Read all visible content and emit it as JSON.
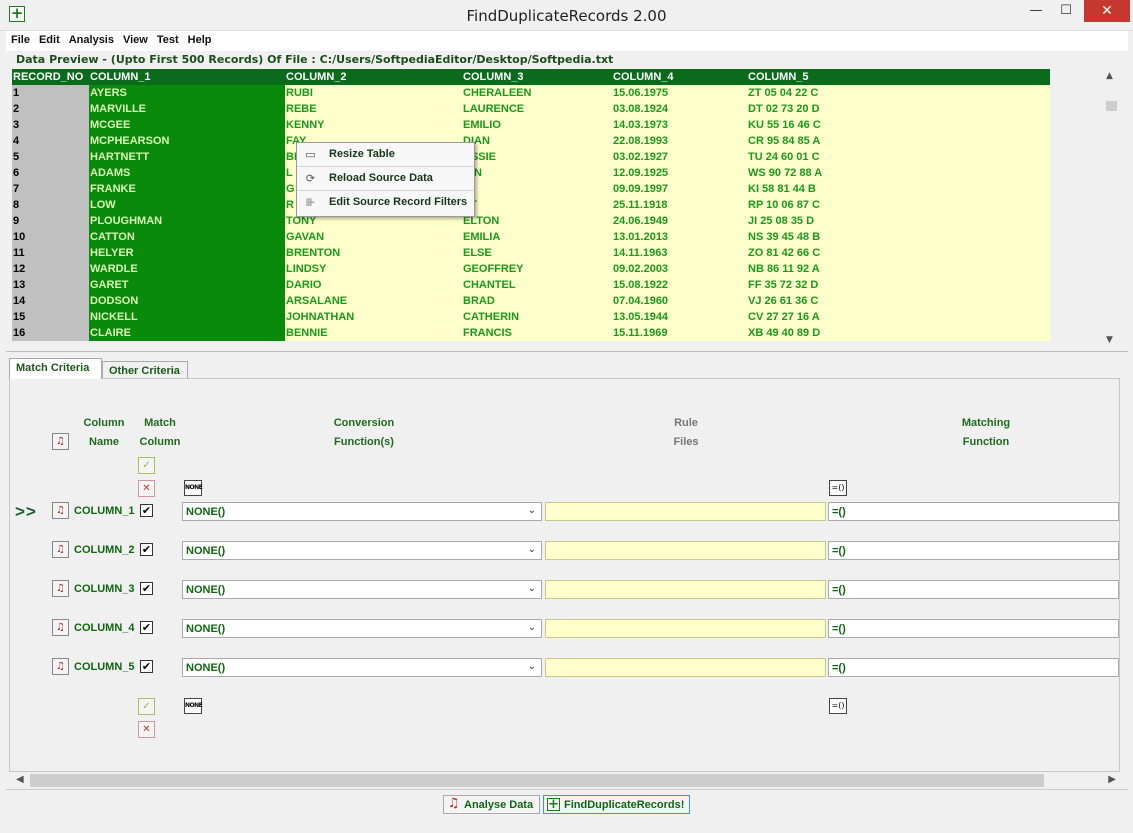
{
  "window": {
    "title": "FindDuplicateRecords 2.00",
    "minimize_glyph": "—",
    "maximize_glyph": "☐",
    "close_glyph": "✕"
  },
  "menu": [
    "File",
    "Edit",
    "Analysis",
    "View",
    "Test",
    "Help"
  ],
  "preview": {
    "caption": "Data Preview - (Upto First 500 Records) Of File  : C:/Users/SoftpediaEditor/Desktop/Softpedia.txt",
    "headers": [
      "RECORD_NO",
      "COLUMN_1",
      "COLUMN_2",
      "COLUMN_3",
      "COLUMN_4",
      "COLUMN_5"
    ],
    "rows": [
      [
        "1",
        "AYERS",
        "RUBI",
        "CHERALEEN",
        "15.06.1975",
        "ZT 05 04 22 C"
      ],
      [
        "2",
        "MARVILLE",
        "REBE",
        "LAURENCE",
        "03.08.1924",
        "DT 02 73 20 D"
      ],
      [
        "3",
        "MCGEE",
        "KENNY",
        "EMILIO",
        "14.03.1973",
        "KU 55 16 46 C"
      ],
      [
        "4",
        "MCPHEARSON",
        "FAY",
        "DIAN",
        "22.08.1993",
        "CR 95 84 85 A"
      ],
      [
        "5",
        "HARTNETT",
        "BI",
        "ASSIE",
        "03.02.1927",
        "TU 24 60 01 C"
      ],
      [
        "6",
        "ADAMS",
        "L",
        "AIN",
        "12.09.1925",
        "WS 90 72 88 A"
      ],
      [
        "7",
        "FRANKE",
        "G",
        "N",
        "09.09.1997",
        "KI 58 81 44 B"
      ],
      [
        "8",
        "LOW",
        "R",
        "AT",
        "25.11.1918",
        "RP 10 06 87 C"
      ],
      [
        "9",
        "PLOUGHMAN",
        "TONY",
        "ELTON",
        "24.06.1949",
        "JI 25 08 35 D"
      ],
      [
        "10",
        "CATTON",
        "GAVAN",
        "EMILIA",
        "13.01.2013",
        "NS 39 45 48 B"
      ],
      [
        "11",
        "HELYER",
        "BRENTON",
        "ELSE",
        "14.11.1963",
        "ZO 81 42 66 C"
      ],
      [
        "12",
        "WARDLE",
        "LINDSY",
        "GEOFFREY",
        "09.02.2003",
        "NB 86 11 92 A"
      ],
      [
        "13",
        "GARET",
        "DARIO",
        "CHANTEL",
        "15.08.1922",
        "FF 35 72 32 D"
      ],
      [
        "14",
        "DODSON",
        "ARSALANE",
        "BRAD",
        "07.04.1960",
        "VJ 26 61 36 C"
      ],
      [
        "15",
        "NICKELL",
        "JOHNATHAN",
        "CATHERIN",
        "13.05.1944",
        "CV 27 27 16 A"
      ],
      [
        "16",
        "CLAIRE",
        "BENNIE",
        "FRANCIS",
        "15.11.1969",
        "XB 49 40 89 D"
      ]
    ]
  },
  "context_menu": {
    "items": [
      {
        "label": "Resize Table",
        "icon": "resize-table-icon",
        "glyph": "▭"
      },
      {
        "label": "Reload Source Data",
        "icon": "reload-icon",
        "glyph": "⟳"
      },
      {
        "label": "Edit Source Record Filters",
        "icon": "filter-icon",
        "glyph": "⊪"
      }
    ]
  },
  "tabs": {
    "match": "Match Criteria",
    "other": "Other Criteria"
  },
  "criteria": {
    "headers": {
      "column_name_1": "Column",
      "column_name_2": "Name",
      "match_column_1": "Match",
      "match_column_2": "Column",
      "conversion_1": "Conversion",
      "conversion_2": "Function(s)",
      "rule_1": "Rule",
      "rule_2": "Files",
      "matching_1": "Matching",
      "matching_2": "Function"
    },
    "indicator": ">>",
    "none_icon_text": "NONE",
    "eq_icon_text": "=()",
    "rows": [
      {
        "name": "COLUMN_1",
        "checked": "✔",
        "function": "NONE()",
        "matching": "=()"
      },
      {
        "name": "COLUMN_2",
        "checked": "✔",
        "function": "NONE()",
        "matching": "=()"
      },
      {
        "name": "COLUMN_3",
        "checked": "✔",
        "function": "NONE()",
        "matching": "=()"
      },
      {
        "name": "COLUMN_4",
        "checked": "✔",
        "function": "NONE()",
        "matching": "=()"
      },
      {
        "name": "COLUMN_5",
        "checked": "✔",
        "function": "NONE()",
        "matching": "=()"
      }
    ]
  },
  "footer": {
    "analyse": "Analyse Data",
    "find": "FindDuplicateRecords!"
  },
  "colors": {
    "header_green": "#0a6b1c",
    "col1_green": "#0a8a0a",
    "cell_yellow": "#ffffcc",
    "text_green": "#1a9a1a"
  }
}
